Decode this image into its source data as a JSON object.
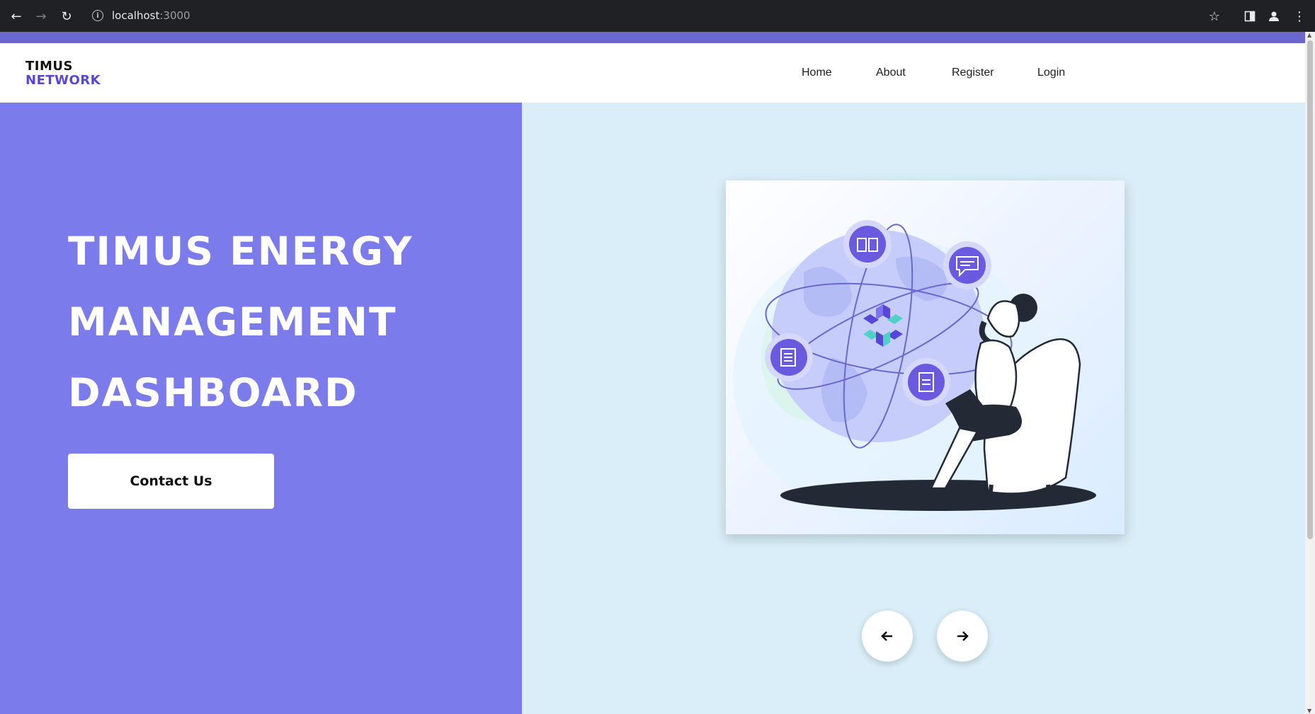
{
  "browser": {
    "url_host": "localhost",
    "url_port": ":3000"
  },
  "brand": {
    "line1": "TIMUS",
    "line2": "NETWORK",
    "accent": "#5747d9"
  },
  "nav": {
    "items": [
      {
        "label": "Home"
      },
      {
        "label": "About"
      },
      {
        "label": "Register"
      },
      {
        "label": "Login"
      }
    ]
  },
  "hero": {
    "title_lines": [
      "TIMUS ENERGY",
      "MANAGEMENT",
      "DASHBOARD"
    ],
    "cta_label": "Contact Us",
    "left_bg": "#7b7beb",
    "right_bg": "#d9eef8"
  },
  "carousel": {
    "prev_icon": "arrow-left-icon",
    "next_icon": "arrow-right-icon"
  }
}
